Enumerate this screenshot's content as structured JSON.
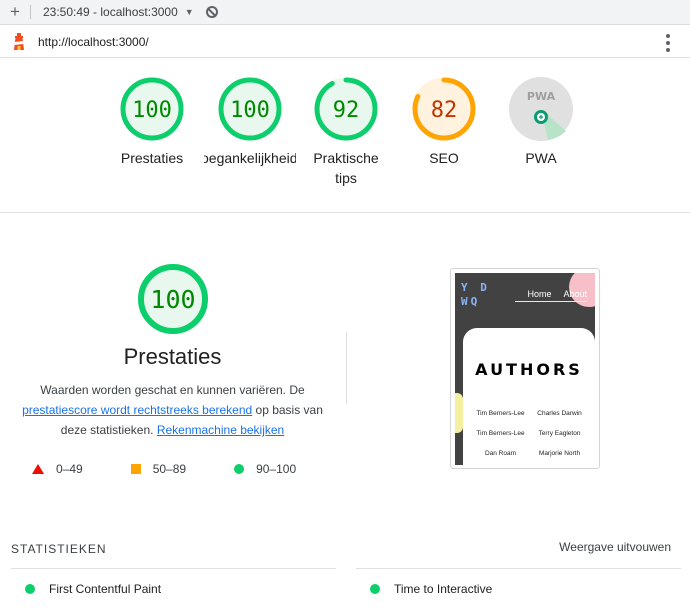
{
  "browser": {
    "timestamp": "23:50:49 - localhost:3000",
    "url": "http://localhost:3000/"
  },
  "colors": {
    "pass": "#0cce6b",
    "average": "#ffa400",
    "fail": "#eb0f00",
    "pass_text": "#008800",
    "average_text": "#c33300"
  },
  "gauges": [
    {
      "score": "100",
      "label": "Prestaties",
      "fraction": 1.0,
      "status": "pass"
    },
    {
      "score": "100",
      "label": "Toegankelijkheid",
      "fraction": 1.0,
      "status": "pass"
    },
    {
      "score": "92",
      "label": "Praktische tips",
      "fraction": 0.92,
      "status": "pass"
    },
    {
      "score": "82",
      "label": "SEO",
      "fraction": 0.82,
      "status": "average"
    },
    {
      "score": "PWA",
      "label": "PWA",
      "fraction": 0,
      "status": "pwa"
    }
  ],
  "summary": {
    "score": "100",
    "title": "Prestaties",
    "desc_1": "Waarden worden geschat en kunnen variëren. De",
    "link_1": "prestatiescore wordt rechtstreeks berekend",
    "desc_2": "op basis van",
    "desc_3": "deze statistieken.",
    "link_2": "Rekenmachine bekijken"
  },
  "legend": [
    {
      "icon": "triangle",
      "range": "0–49"
    },
    {
      "icon": "square",
      "range": "50–89"
    },
    {
      "icon": "circle",
      "range": "90–100"
    }
  ],
  "screenshot": {
    "logo": "Y D\nWQ",
    "nav": [
      "Home",
      "About"
    ],
    "heading": "AUTHORS",
    "authors": [
      "Tim Berners-Lee",
      "Charles Darwin",
      "Tim Berners-Lee",
      "Terry Eagleton",
      "Dan Roam",
      "Marjorie North"
    ]
  },
  "stats": {
    "heading": "STATISTIEKEN",
    "toggle": "Weergave uitvouwen",
    "metrics": [
      "First Contentful Paint",
      "Time to Interactive"
    ]
  }
}
